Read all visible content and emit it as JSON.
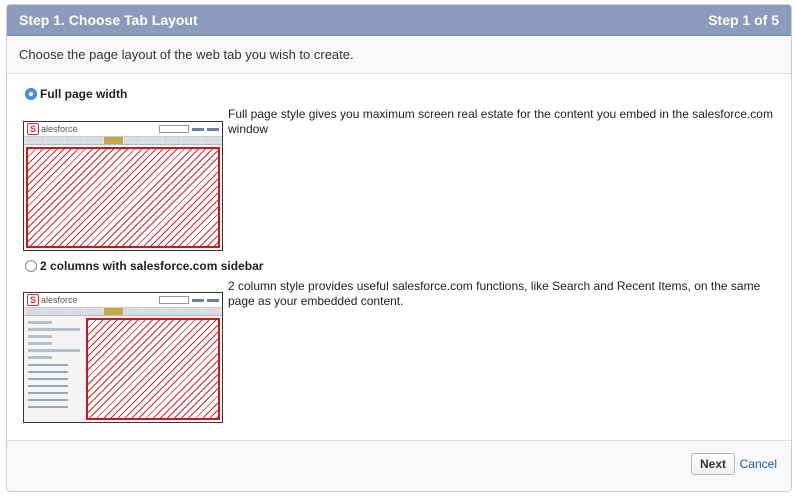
{
  "header": {
    "title": "Step 1. Choose Tab Layout",
    "step": "Step 1 of 5"
  },
  "intro": "Choose the page layout of the web tab you wish to create.",
  "options": [
    {
      "label": "Full page width",
      "selected": true,
      "description": "Full page style gives you maximum screen real estate for the content you embed in the salesforce.com window"
    },
    {
      "label": "2 columns with salesforce.com sidebar",
      "selected": false,
      "description": "2 column style provides useful salesforce.com functions, like Search and Recent Items, on the same page as your embedded content."
    }
  ],
  "thumbnail": {
    "logo_letter": "S",
    "logo_rest": "alesforce"
  },
  "footer": {
    "next_label": "Next",
    "cancel_label": "Cancel"
  },
  "colors": {
    "header_bg": "#8b9bbd",
    "radio_selected": "#4a90e2",
    "hatch": "#d32626",
    "link": "#1a5fa8"
  }
}
